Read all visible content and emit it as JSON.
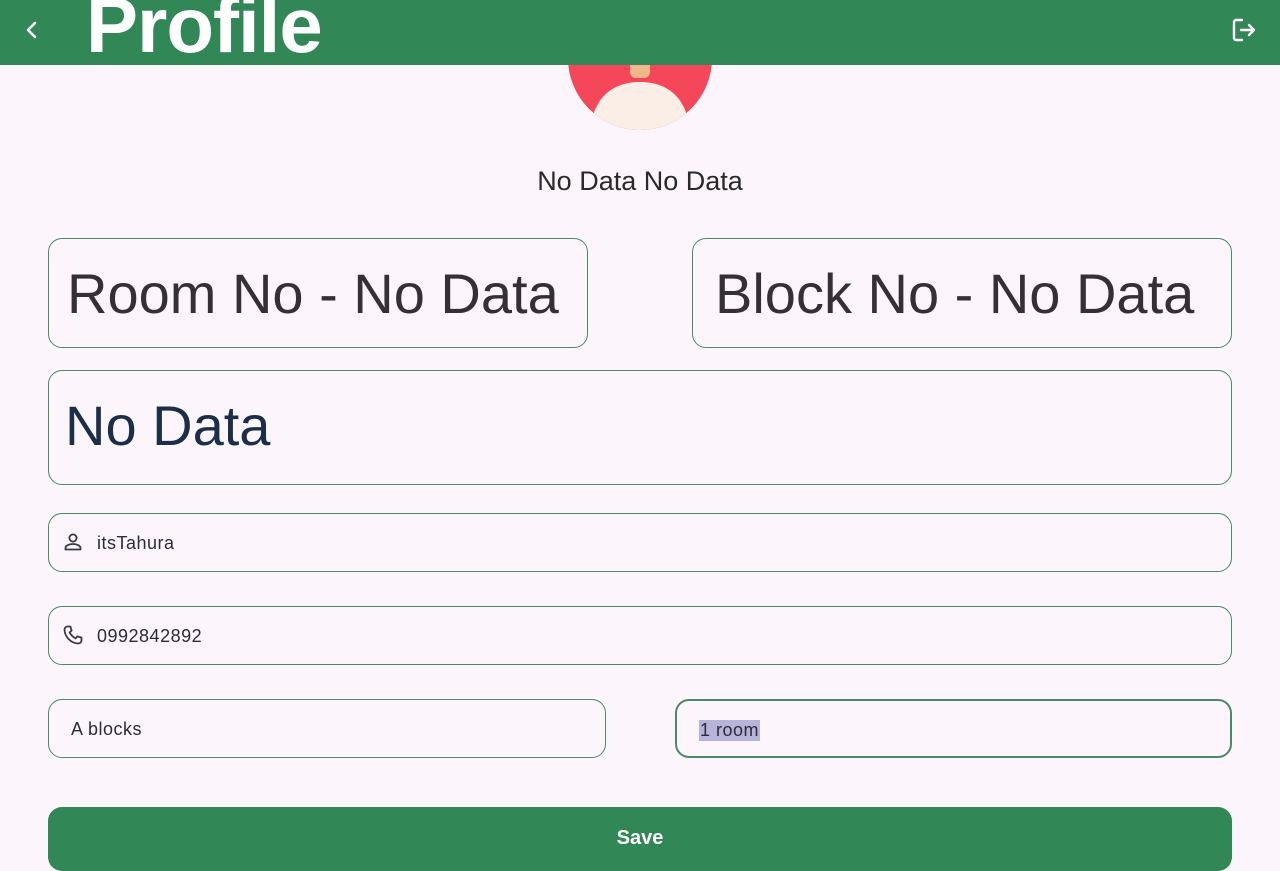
{
  "appbar": {
    "title": "Profile",
    "back_icon": "chevron-left-icon",
    "logout_icon": "logout-icon",
    "color": "#328757"
  },
  "profile": {
    "full_name": "No Data No Data",
    "room_text": "Room No - No Data",
    "block_text": "Block No - No Data",
    "info_text": "No Data"
  },
  "form": {
    "username": {
      "icon": "person-icon",
      "value": "itsTahura"
    },
    "phone": {
      "icon": "phone-icon",
      "value": "0992842892"
    },
    "block": {
      "value": "A blocks"
    },
    "room": {
      "value": "1 room"
    }
  },
  "actions": {
    "save_label": "Save"
  }
}
